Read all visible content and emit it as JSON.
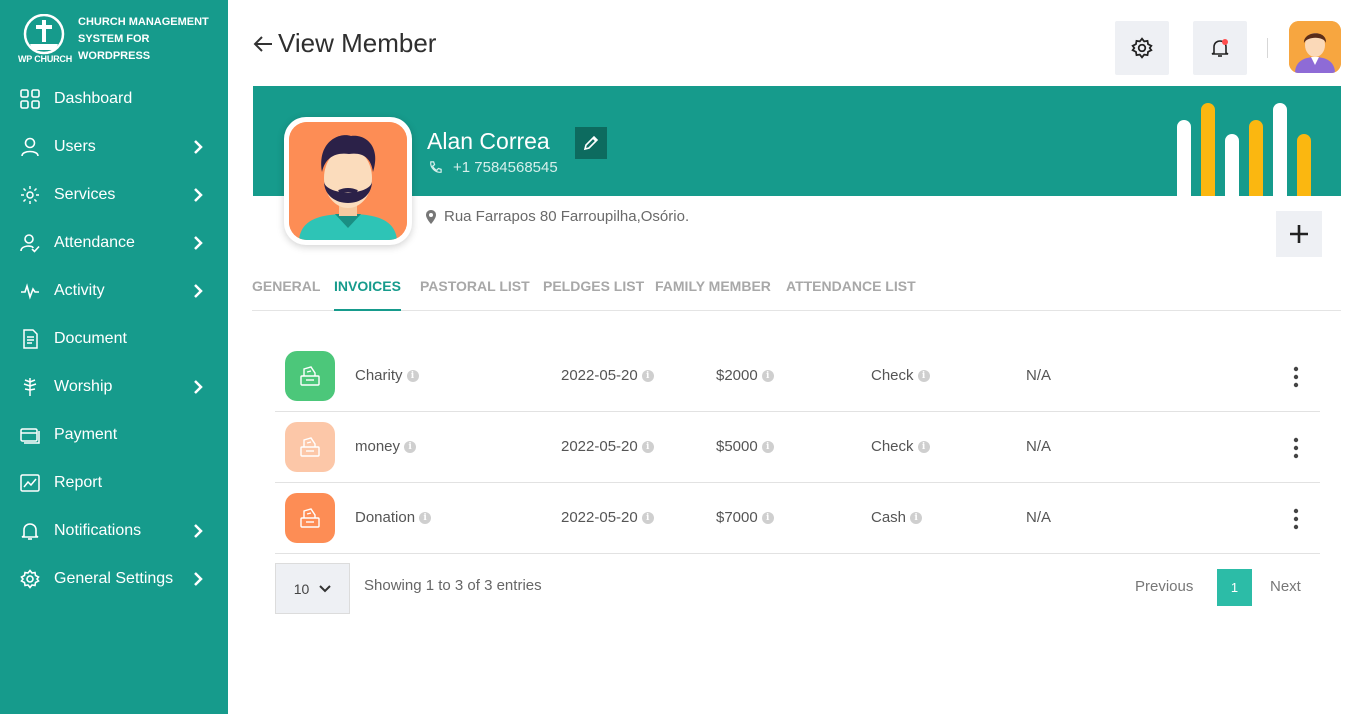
{
  "brand": {
    "logo_text": "WP CHURCH",
    "name": "CHURCH MANAGEMENT SYSTEM FOR WORDPRESS"
  },
  "sidebar": {
    "items": [
      {
        "label": "Dashboard",
        "icon": "dashboard-icon",
        "has_submenu": false
      },
      {
        "label": "Users",
        "icon": "user-icon",
        "has_submenu": true
      },
      {
        "label": "Services",
        "icon": "services-icon",
        "has_submenu": true
      },
      {
        "label": "Attendance",
        "icon": "attendance-icon",
        "has_submenu": true
      },
      {
        "label": "Activity",
        "icon": "activity-pulse-icon",
        "has_submenu": true
      },
      {
        "label": "Document",
        "icon": "document-icon",
        "has_submenu": false
      },
      {
        "label": "Worship",
        "icon": "worship-icon",
        "has_submenu": true
      },
      {
        "label": "Payment",
        "icon": "payment-icon",
        "has_submenu": false
      },
      {
        "label": "Report",
        "icon": "report-icon",
        "has_submenu": false
      },
      {
        "label": "Notifications",
        "icon": "bell-icon",
        "has_submenu": true
      },
      {
        "label": "General Settings",
        "icon": "gear-icon",
        "has_submenu": true
      }
    ]
  },
  "header": {
    "title": "View Member"
  },
  "member": {
    "name": "Alan Correa",
    "phone": "+1 7584568545",
    "address": "Rua Farrapos 80 Farroupilha,Osório."
  },
  "tabs": [
    {
      "label": "GENERAL",
      "active": false
    },
    {
      "label": "INVOICES",
      "active": true
    },
    {
      "label": "PASTORAL LIST",
      "active": false
    },
    {
      "label": "PELDGES LIST",
      "active": false
    },
    {
      "label": "FAMILY MEMBER",
      "active": false
    },
    {
      "label": "ATTENDANCE LIST",
      "active": false
    }
  ],
  "invoices": {
    "rows": [
      {
        "title": "Charity",
        "date": "2022-05-20",
        "amount": "$2000",
        "method": "Check",
        "note": "N/A",
        "icon_color": "#4cc77a"
      },
      {
        "title": "money",
        "date": "2022-05-20",
        "amount": "$5000",
        "method": "Check",
        "note": "N/A",
        "icon_color": "#fcc7a8"
      },
      {
        "title": "Donation",
        "date": "2022-05-20",
        "amount": "$7000",
        "method": "Cash",
        "note": "N/A",
        "icon_color": "#fd8d55"
      }
    ]
  },
  "pagination": {
    "page_size": "10",
    "showing": "Showing 1 to 3 of 3 entries",
    "previous": "Previous",
    "current_page": "1",
    "next": "Next"
  },
  "colors": {
    "primary": "#169b8c",
    "accent_bar": "#fbb710",
    "page_active": "#2cbca7"
  }
}
